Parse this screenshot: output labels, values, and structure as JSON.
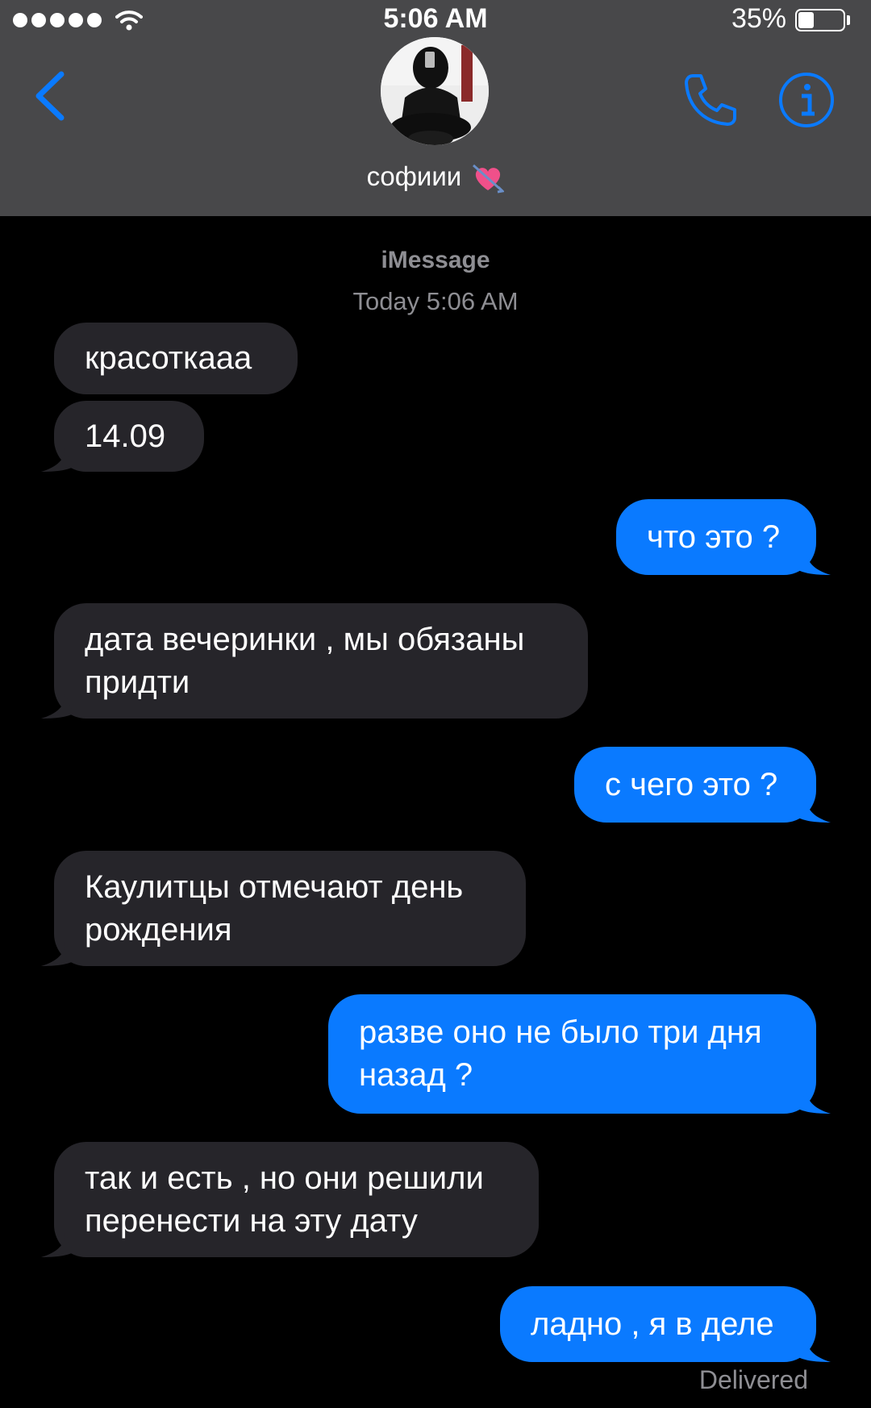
{
  "status_bar": {
    "time": "5:06 AM",
    "battery_percent": "35%",
    "battery_level": 0.35
  },
  "header": {
    "contact_name": "софиии",
    "icons": [
      "back-chevron-icon",
      "phone-icon",
      "info-icon"
    ]
  },
  "conversation": {
    "service": "iMessage",
    "timestamp": "Today 5:06 AM",
    "messages": [
      {
        "from": "them",
        "text": "красоткааа"
      },
      {
        "from": "them",
        "text": "14.09"
      },
      {
        "from": "me",
        "text": "что это ?"
      },
      {
        "from": "them",
        "text": "дата вечеринки , мы обязаны придти"
      },
      {
        "from": "me",
        "text": "с чего это ?"
      },
      {
        "from": "them",
        "text": "Каулитцы отмечают день рождения"
      },
      {
        "from": "me",
        "text": "разве оно не было три дня назад ?"
      },
      {
        "from": "them",
        "text": "так и есть , но они решили перенести на эту дату"
      },
      {
        "from": "me",
        "text": "ладно , я в деле"
      }
    ],
    "status": "Delivered"
  },
  "colors": {
    "header_bg": "#48484a",
    "incoming_bubble": "#26252a",
    "outgoing_bubble": "#0a7aff",
    "accent": "#0a7aff",
    "meta_text": "#8e8e93"
  }
}
